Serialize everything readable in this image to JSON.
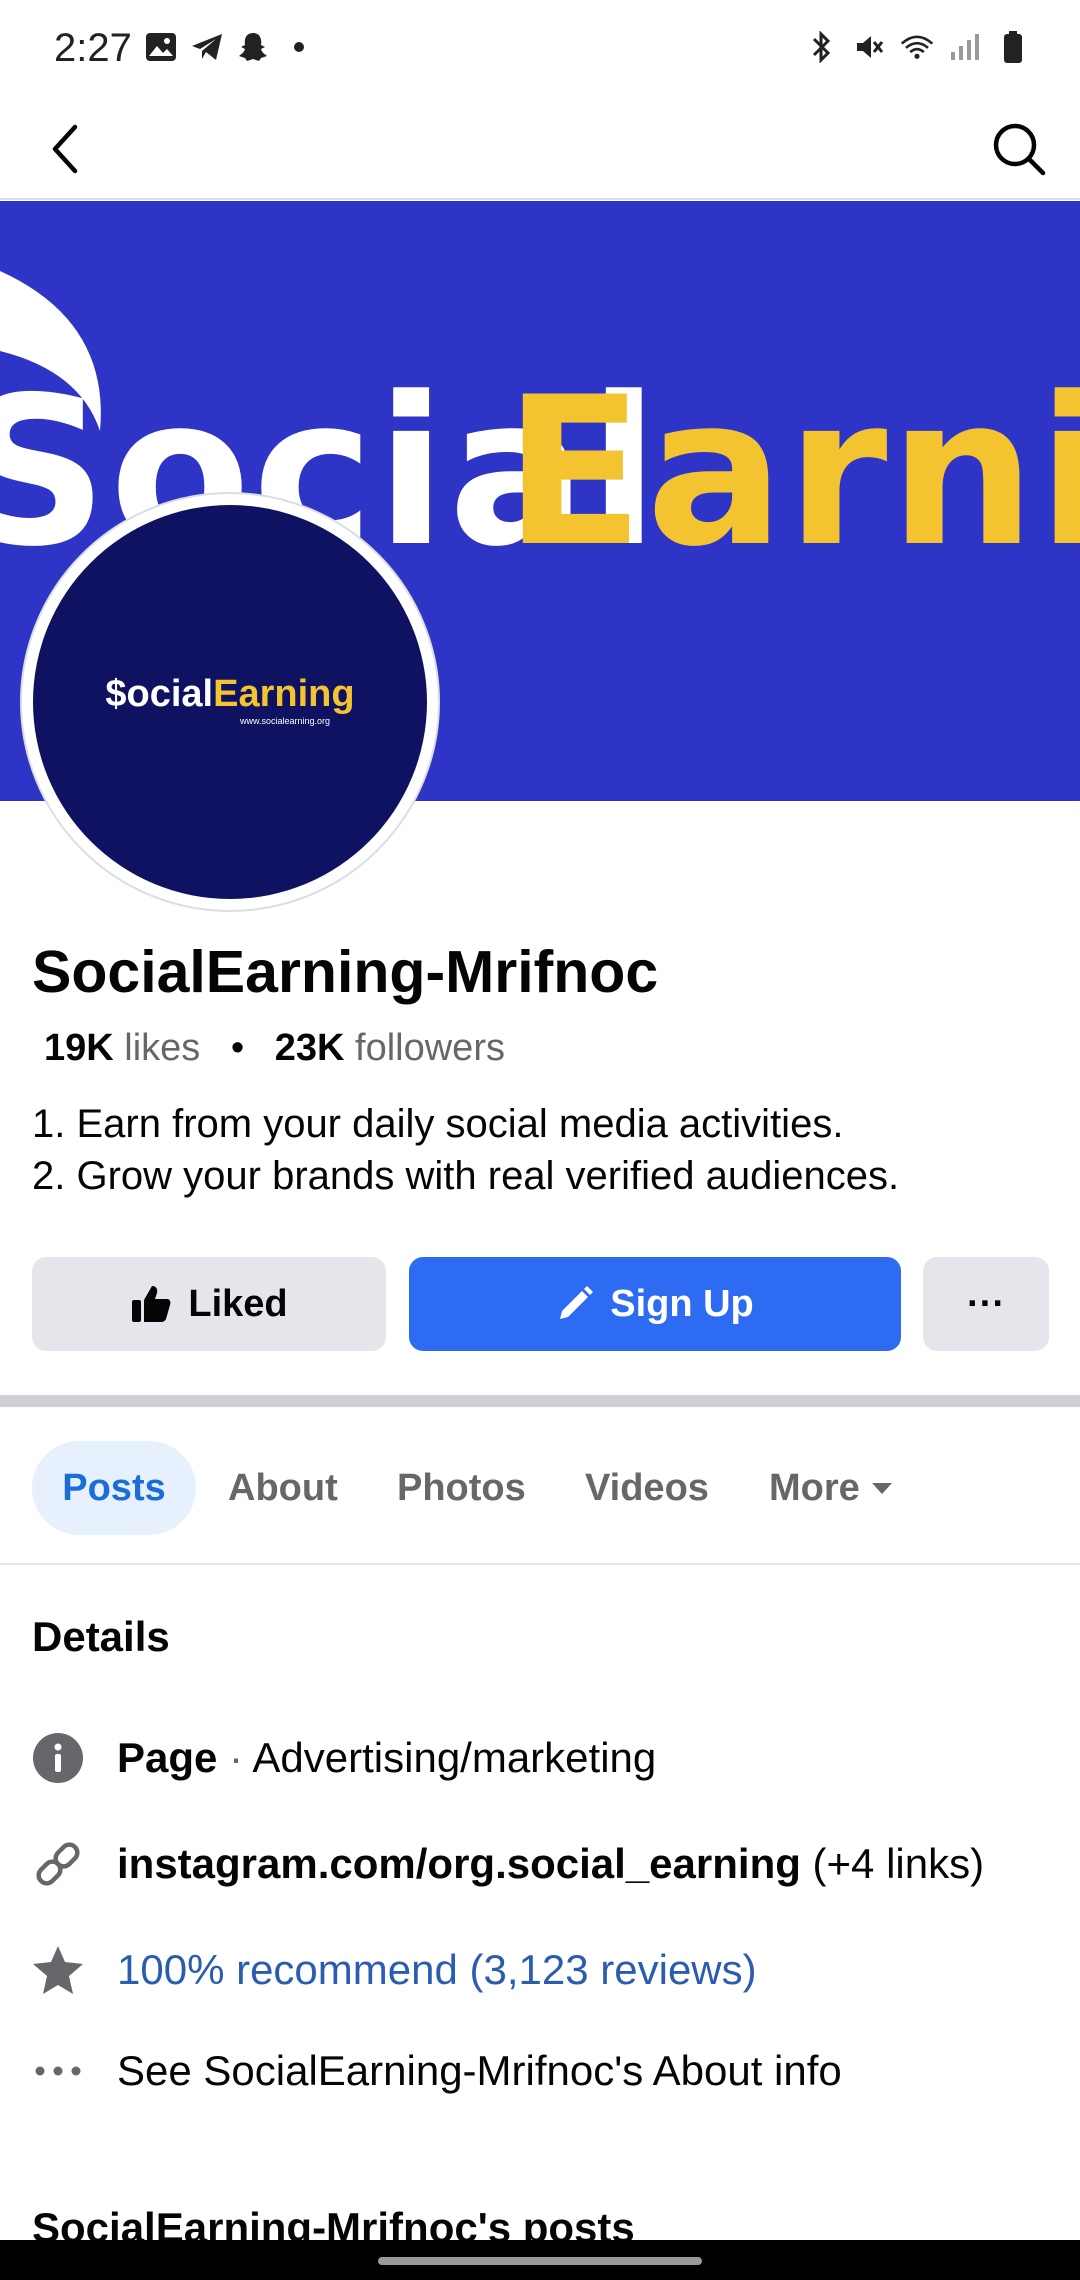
{
  "status_bar": {
    "time": "2:27",
    "left_icons": [
      "image-icon",
      "telegram-icon",
      "snapchat-icon",
      "dot-icon"
    ],
    "right_icons": [
      "bluetooth-icon",
      "mute-icon",
      "wifi-icon",
      "signal-icon",
      "battery-icon"
    ]
  },
  "nav": {
    "back_icon": "back-arrow-icon",
    "search_icon": "search-icon"
  },
  "cover": {
    "word_white": "SocialEarnin",
    "word_white_part": "Social",
    "word_yellow_part": "Earnin",
    "bg_color": "#2e35c6",
    "accent": "#f4c430"
  },
  "avatar": {
    "text_white": "$ocial",
    "text_yellow": "Earning",
    "subtext": "www.socialearning.org"
  },
  "page": {
    "title": "SocialEarning-Mrifnoc",
    "likes_count": "19K",
    "likes_label": "likes",
    "followers_count": "23K",
    "followers_label": "followers",
    "bio_line1": "1. Earn from your daily social media activities.",
    "bio_line2": "2. Grow your brands with real verified audiences."
  },
  "actions": {
    "liked_label": "Liked",
    "signup_label": "Sign Up",
    "more_label": "···"
  },
  "tabs": [
    {
      "label": "Posts",
      "active": true
    },
    {
      "label": "About",
      "active": false
    },
    {
      "label": "Photos",
      "active": false
    },
    {
      "label": "Videos",
      "active": false
    },
    {
      "label": "More",
      "active": false
    }
  ],
  "details": {
    "title": "Details",
    "page_label": "Page",
    "page_sep": " · ",
    "page_category": "Advertising/marketing",
    "link_url": "instagram.com/org.social_earning",
    "link_extra": " (+4 links)",
    "recommend": "100% recommend (3,123 reviews)",
    "about_info": "See SocialEarning-Mrifnoc's About info"
  },
  "posts_heading": "SocialEarning-Mrifnoc's posts",
  "colors": {
    "primary_blue": "#2d6cf2",
    "link_blue": "#2a5db0",
    "gray_button": "#e4e6eb"
  }
}
